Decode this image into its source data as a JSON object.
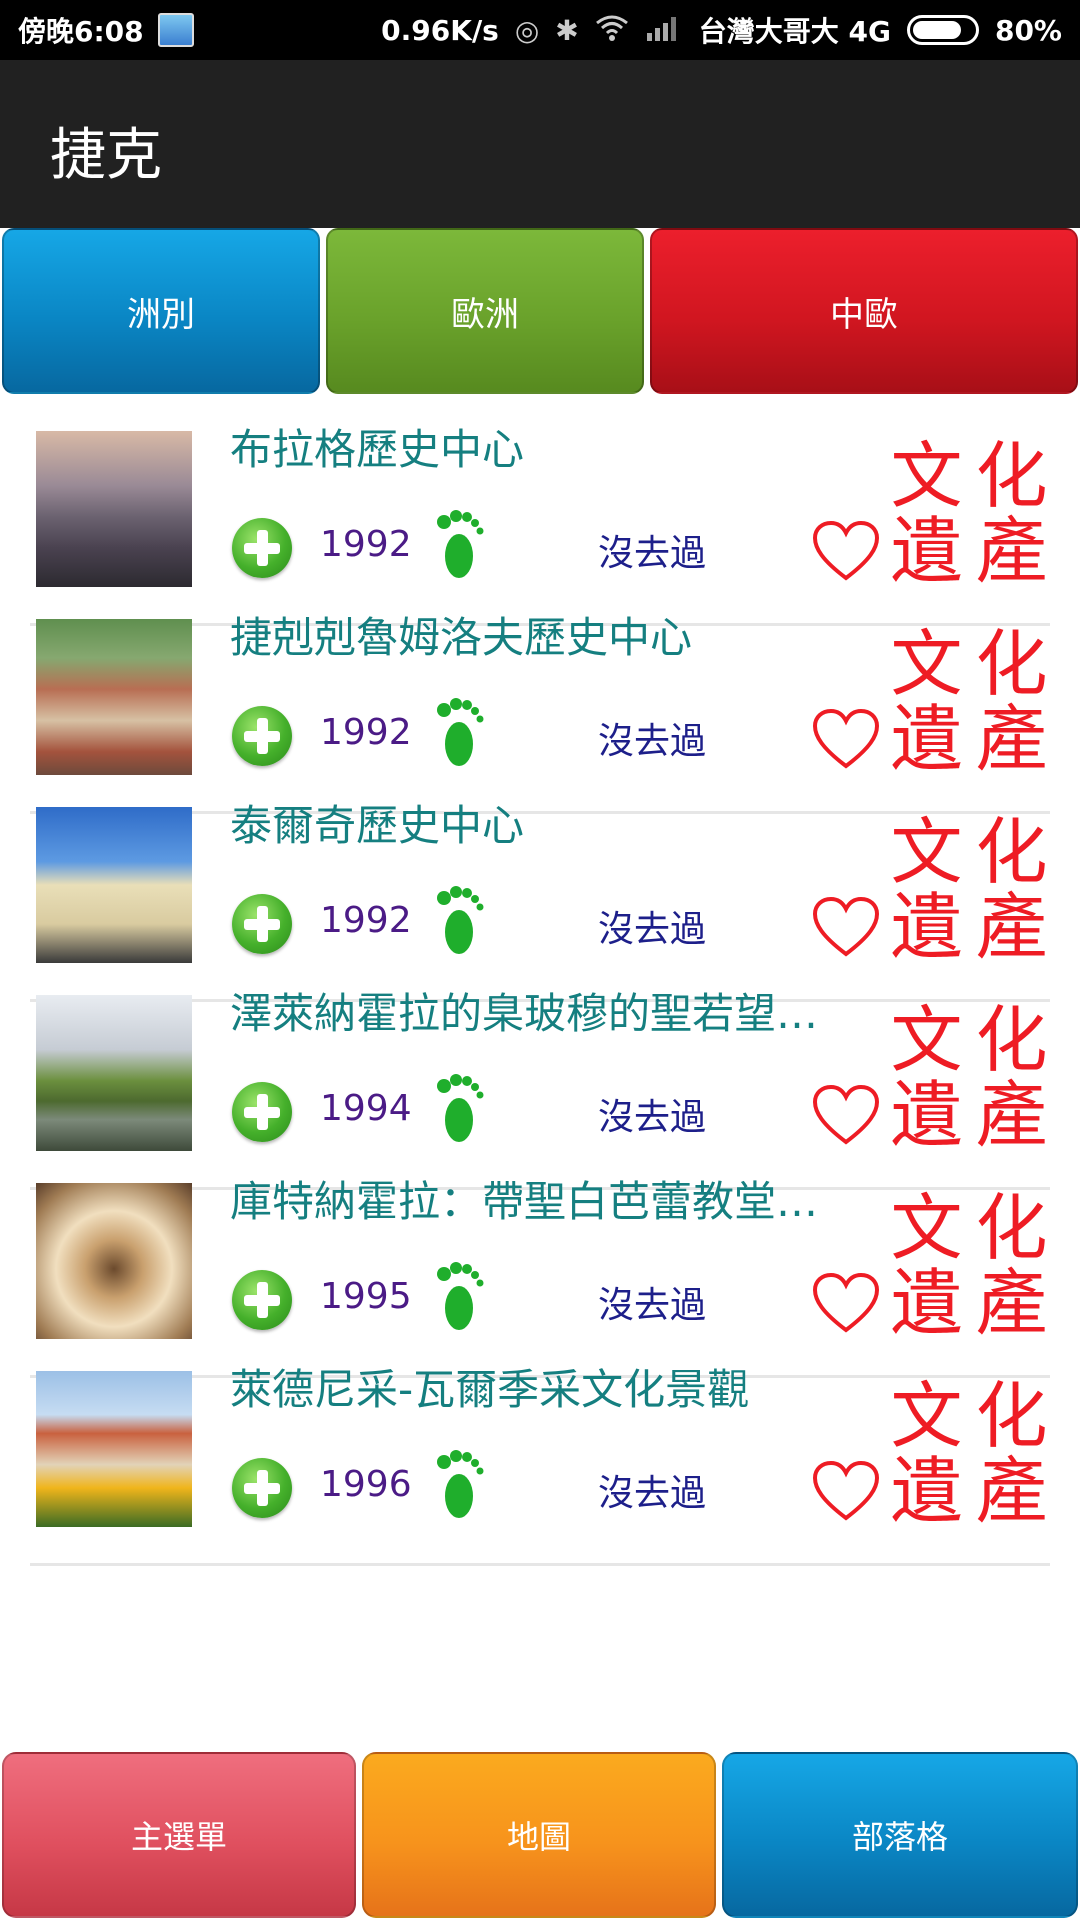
{
  "status_bar": {
    "time": "傍晚6:08",
    "speed": "0.96K/s",
    "carrier": "台灣大哥大 4G",
    "battery": "80%",
    "battery_level": 0.8
  },
  "app_bar": {
    "title": "捷克"
  },
  "tabs": [
    {
      "label": "洲別"
    },
    {
      "label": "歐洲"
    },
    {
      "label": "中歐"
    }
  ],
  "badge": {
    "chars": [
      "文",
      "化",
      "遺",
      "產"
    ]
  },
  "items": [
    {
      "title": "布拉格歷史中心",
      "year": "1992",
      "status": "沒去過"
    },
    {
      "title": "捷剋剋魯姆洛夫歷史中心",
      "year": "1992",
      "status": "沒去過"
    },
    {
      "title": "泰爾奇歷史中心",
      "year": "1992",
      "status": "沒去過"
    },
    {
      "title": "澤萊納霍拉的臬玻穆的聖若望…",
      "year": "1994",
      "status": "沒去過"
    },
    {
      "title": "庫特納霍拉：帶聖白芭蕾教堂…",
      "year": "1995",
      "status": "沒去過"
    },
    {
      "title": "萊德尼采-瓦爾季采文化景觀",
      "year": "1996",
      "status": "沒去過"
    }
  ],
  "bottom_nav": [
    {
      "label": "主選單"
    },
    {
      "label": "地圖"
    },
    {
      "label": "部落格"
    }
  ],
  "colors": {
    "title_teal": "#157f80",
    "year_purple": "#4b1b86",
    "status_navy": "#1d1f8a",
    "heritage_red": "#ee1c24"
  }
}
